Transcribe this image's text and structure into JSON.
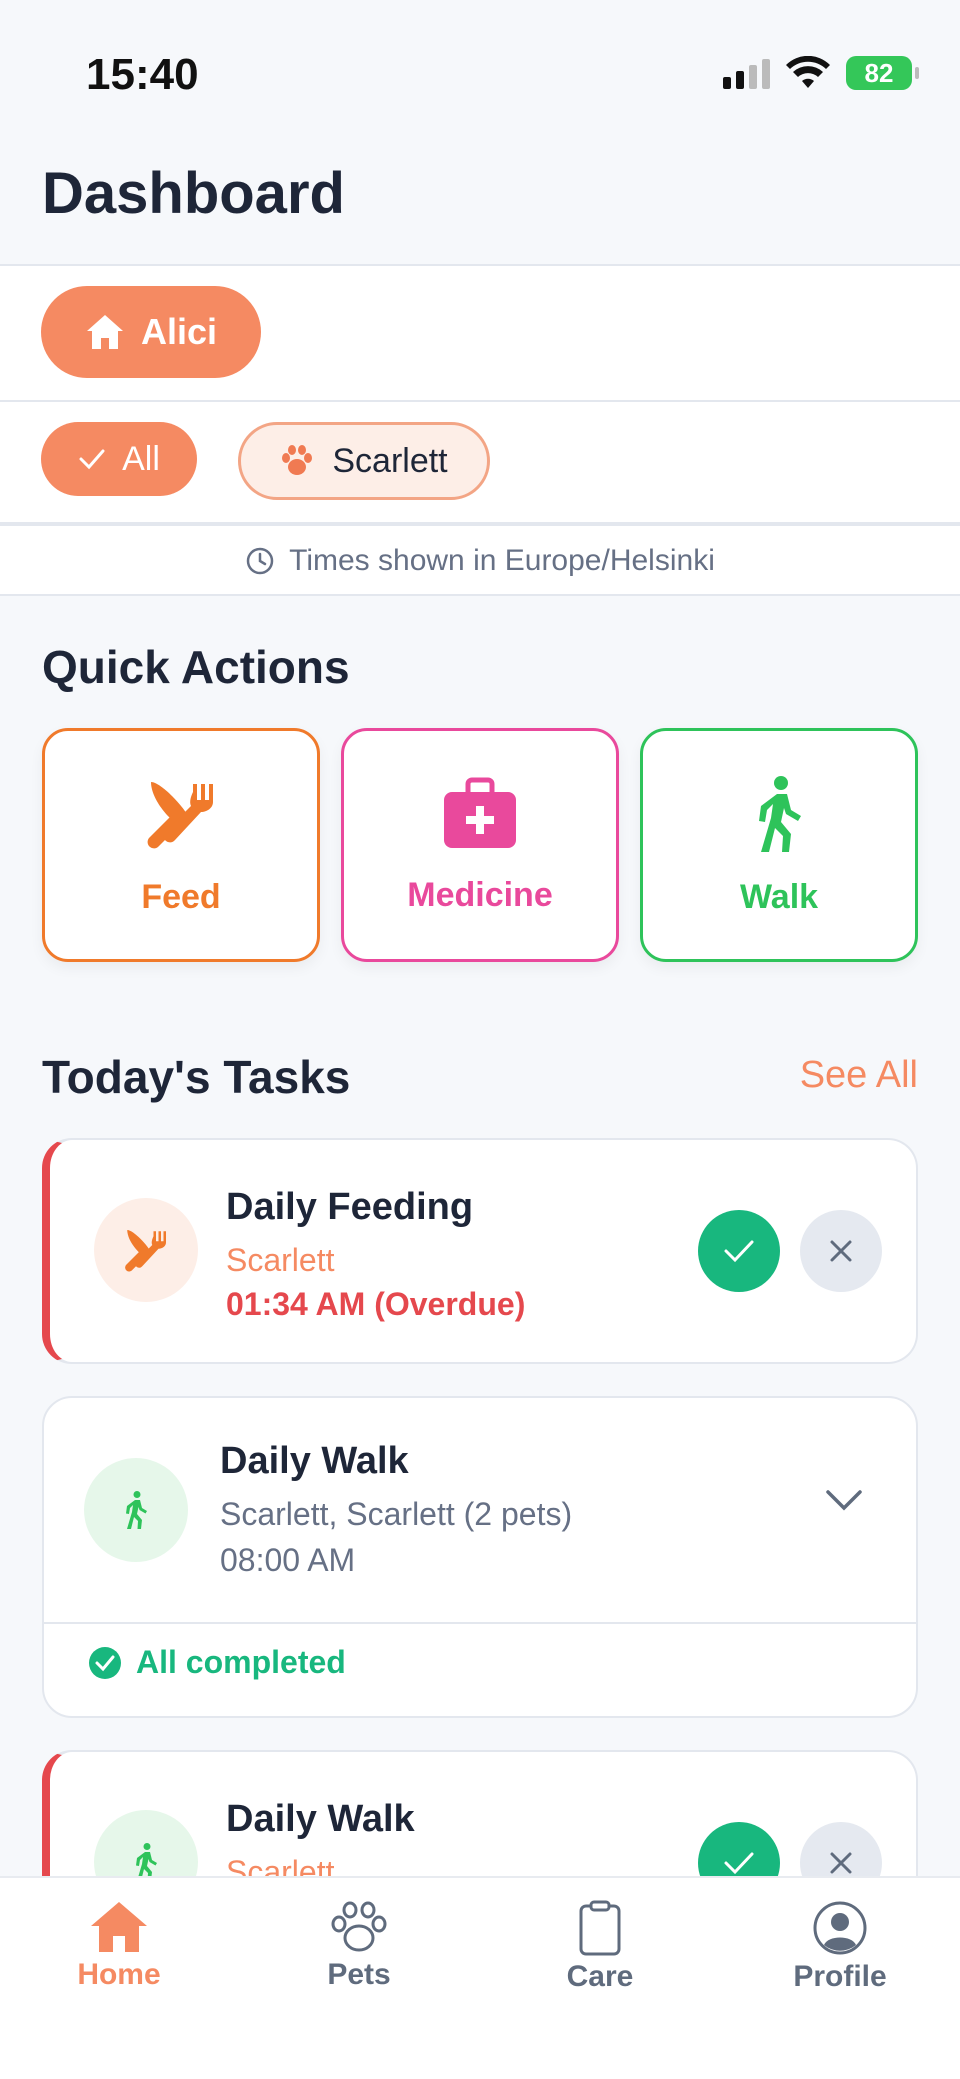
{
  "status_bar": {
    "time": "15:40",
    "battery": "82"
  },
  "header": {
    "title": "Dashboard"
  },
  "household": {
    "name": "Alici"
  },
  "filters": {
    "all_label": "All",
    "pet_label": "Scarlett"
  },
  "timezone_note": "Times shown in Europe/Helsinki",
  "quick_actions": {
    "title": "Quick Actions",
    "feed": "Feed",
    "medicine": "Medicine",
    "walk": "Walk"
  },
  "tasks": {
    "title": "Today's Tasks",
    "see_all": "See All",
    "items": [
      {
        "title": "Daily Feeding",
        "pet": "Scarlett",
        "time": "01:34 AM (Overdue)"
      },
      {
        "title": "Daily Walk",
        "pet": "Scarlett, Scarlett (2 pets)",
        "time": "08:00 AM",
        "status": "All completed"
      },
      {
        "title": "Daily Walk",
        "pet": "Scarlett"
      }
    ]
  },
  "tabs": {
    "home": "Home",
    "pets": "Pets",
    "care": "Care",
    "profile": "Profile"
  },
  "colors": {
    "accent": "#f58a62",
    "feed": "#f07a2b",
    "medicine": "#e9499c",
    "walk": "#2ec35a",
    "success": "#18b77e",
    "overdue": "#e5484d"
  }
}
